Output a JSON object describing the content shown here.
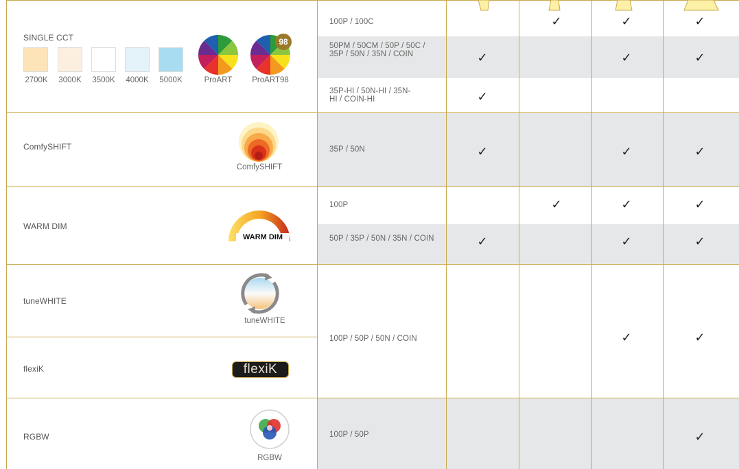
{
  "rows": {
    "single_cct": {
      "label": "SINGLE CCT",
      "swatches": [
        {
          "label": "2700K",
          "color": "#fde3b8"
        },
        {
          "label": "3000K",
          "color": "#fcefe0"
        },
        {
          "label": "3500K",
          "color": "#ffffff"
        },
        {
          "label": "4000K",
          "color": "#e4f2fa"
        },
        {
          "label": "5000K",
          "color": "#a8dcf0"
        }
      ],
      "icons": [
        {
          "label": "ProART"
        },
        {
          "label": "ProART98",
          "badge": "98"
        }
      ],
      "variants": [
        {
          "models": "100P / 100C",
          "checks": [
            false,
            true,
            true,
            true
          ]
        },
        {
          "models": "50PM / 50CM / 50P / 50C / 35P / 50N / 35N / COIN",
          "checks": [
            true,
            false,
            true,
            true
          ]
        },
        {
          "models": "35P-HI / 50N-HI / 35N-HI / COIN-HI",
          "checks": [
            true,
            false,
            false,
            false
          ]
        }
      ]
    },
    "comfyshift": {
      "label": "ComfySHIFT",
      "icon_label": "ComfySHIFT",
      "variants": [
        {
          "models": "35P / 50N",
          "checks": [
            true,
            false,
            true,
            true
          ]
        }
      ]
    },
    "warm_dim": {
      "label": "WARM DIM",
      "icon_label": "WARM DIM",
      "variants": [
        {
          "models": "100P",
          "checks": [
            false,
            true,
            true,
            true
          ]
        },
        {
          "models": "50P / 35P / 50N / 35N / COIN",
          "checks": [
            true,
            false,
            true,
            true
          ]
        }
      ]
    },
    "tunewhite": {
      "label": "tuneWHITE",
      "icon_label": "tuneWHITE"
    },
    "flexik": {
      "label": "flexiK",
      "icon_label": "flexiK"
    },
    "tunewhite_flexik_shared": {
      "models": "100P / 50P / 50N / COIN",
      "checks": [
        false,
        false,
        true,
        true
      ]
    },
    "rgbw": {
      "label": "RGBW",
      "icon_label": "RGBW",
      "variants": [
        {
          "models": "100P / 50P",
          "checks": [
            false,
            false,
            false,
            true
          ]
        }
      ]
    }
  },
  "check_glyph": "✓",
  "colors": {
    "grid_line": "#c9a84a",
    "shaded_row": "#e6e7e8"
  }
}
